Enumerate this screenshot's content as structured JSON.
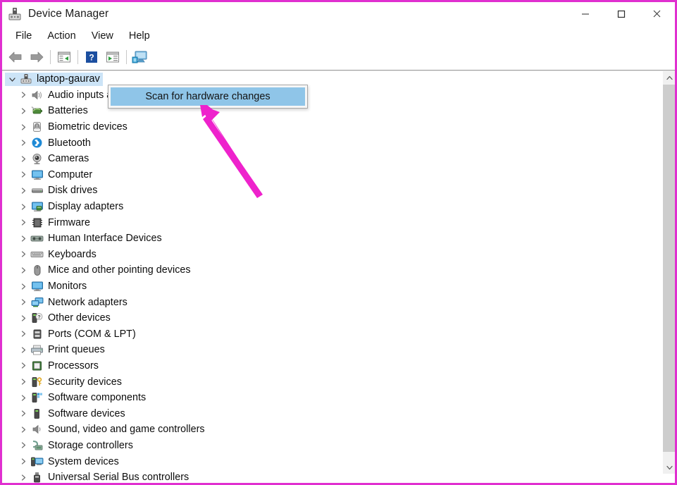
{
  "window": {
    "title": "Device Manager",
    "title_icon": "device-manager-icon",
    "controls": {
      "minimize": "minimize-icon",
      "maximize": "maximize-icon",
      "close": "close-icon"
    }
  },
  "menubar": {
    "items": [
      {
        "label": "File"
      },
      {
        "label": "Action"
      },
      {
        "label": "View"
      },
      {
        "label": "Help"
      }
    ]
  },
  "toolbar": {
    "buttons": [
      {
        "name": "back-arrow-icon",
        "tooltip": "Back"
      },
      {
        "name": "forward-arrow-icon",
        "tooltip": "Forward"
      },
      {
        "name": "show-hide-console-tree-icon",
        "tooltip": "Show/Hide Console Tree"
      },
      {
        "name": "help-icon",
        "tooltip": "Help"
      },
      {
        "name": "properties-icon",
        "tooltip": "Properties"
      },
      {
        "name": "scan-for-hardware-changes-icon",
        "tooltip": "Scan for hardware changes"
      }
    ]
  },
  "tree": {
    "root": {
      "label": "laptop-gaurav",
      "icon": "computer-node-icon",
      "expanded": true,
      "selected": true,
      "chevron": "chevron-down-icon"
    },
    "items": [
      {
        "label": "Audio inputs and outputs",
        "icon": "speaker-icon"
      },
      {
        "label": "Batteries",
        "icon": "battery-icon"
      },
      {
        "label": "Biometric devices",
        "icon": "fingerprint-icon"
      },
      {
        "label": "Bluetooth",
        "icon": "bluetooth-icon"
      },
      {
        "label": "Cameras",
        "icon": "camera-icon"
      },
      {
        "label": "Computer",
        "icon": "monitor-icon"
      },
      {
        "label": "Disk drives",
        "icon": "disk-drive-icon"
      },
      {
        "label": "Display adapters",
        "icon": "display-adapter-icon"
      },
      {
        "label": "Firmware",
        "icon": "firmware-icon"
      },
      {
        "label": "Human Interface Devices",
        "icon": "hid-icon"
      },
      {
        "label": "Keyboards",
        "icon": "keyboard-icon"
      },
      {
        "label": "Mice and other pointing devices",
        "icon": "mouse-icon"
      },
      {
        "label": "Monitors",
        "icon": "monitor-icon"
      },
      {
        "label": "Network adapters",
        "icon": "network-adapter-icon"
      },
      {
        "label": "Other devices",
        "icon": "other-devices-icon"
      },
      {
        "label": "Ports (COM & LPT)",
        "icon": "port-icon"
      },
      {
        "label": "Print queues",
        "icon": "printer-icon"
      },
      {
        "label": "Processors",
        "icon": "processor-icon"
      },
      {
        "label": "Security devices",
        "icon": "security-device-icon"
      },
      {
        "label": "Software components",
        "icon": "software-component-icon"
      },
      {
        "label": "Software devices",
        "icon": "software-device-icon"
      },
      {
        "label": "Sound, video and game controllers",
        "icon": "sound-controller-icon"
      },
      {
        "label": "Storage controllers",
        "icon": "storage-controller-icon"
      },
      {
        "label": "System devices",
        "icon": "system-device-icon"
      },
      {
        "label": "Universal Serial Bus controllers",
        "icon": "usb-controller-icon"
      }
    ],
    "collapsed_chevron": "chevron-right-icon"
  },
  "context_menu": {
    "items": [
      {
        "label": "Scan for hardware changes",
        "highlighted": true
      }
    ]
  },
  "scrollbar": {
    "up_arrow": "scroll-up-icon",
    "down_arrow": "scroll-down-icon",
    "thumb": "scrollbar-thumb"
  },
  "annotation": {
    "arrow": "pink-pointer-arrow",
    "color": "#ee22cc",
    "points_to": "Scan for hardware changes"
  },
  "colors": {
    "window_border": "#e02fd0",
    "selection": "#cce4f7",
    "menu_highlight": "#8fc5e8",
    "annotation_pink": "#ee22cc"
  }
}
